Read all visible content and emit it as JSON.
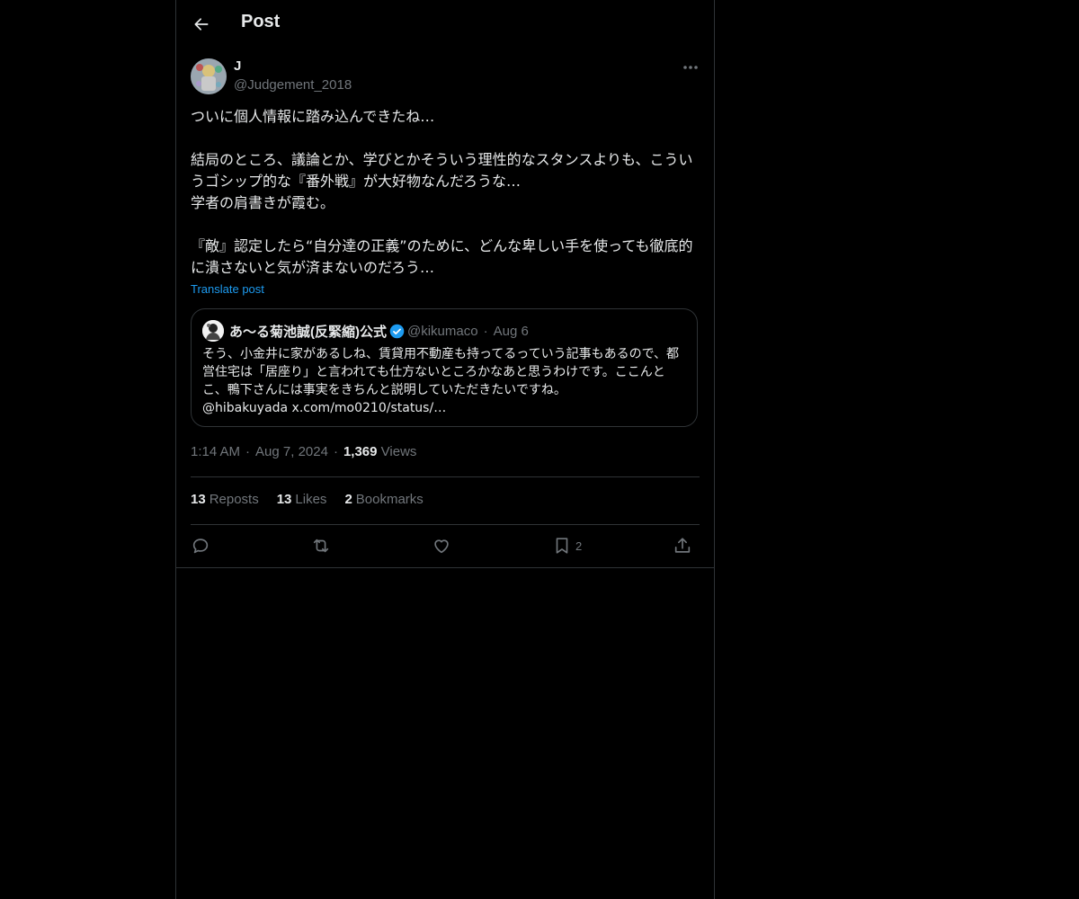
{
  "header": {
    "title": "Post",
    "back_icon": "arrow-left-icon"
  },
  "post": {
    "author": {
      "display_name": "J",
      "handle": "@Judgement_2018"
    },
    "body": "ついに個人情報に踏み込んできたね…\n\n結局のところ、議論とか、学びとかそういう理性的なスタンスよりも、こういうゴシップ的な『番外戦』が大好物なんだろうな…\n学者の肩書きが霞む。\n\n『敵』認定したら“自分達の正義”のために、どんな卑しい手を使っても徹底的に潰さないと気が済まないのだろう…",
    "translate_label": "Translate post",
    "time": "1:14 AM",
    "date": "Aug 7, 2024",
    "views_count": "1,369",
    "views_label": "Views"
  },
  "quote": {
    "display_name": "あ〜る菊池誠(反緊縮)公式",
    "handle": "@kikumaco",
    "date": "Aug 6",
    "text": "そう、小金井に家があるしね、賃貸用不動産も持ってるっていう記事もあるので、都営住宅は「居座り」と言われても仕方ないところかなあと思うわけです。ここんとこ、鴨下さんには事実をきちんと説明していただきたいですね。\n@hibakuyada x.com/mo0210/status/…",
    "verified_color": "#1d9bf0"
  },
  "stats": {
    "reposts_count": "13",
    "reposts_label": "Reposts",
    "likes_count": "13",
    "likes_label": "Likes",
    "bookmarks_count": "2",
    "bookmarks_label": "Bookmarks"
  },
  "actions": {
    "reply_icon": "reply-icon",
    "repost_icon": "repost-icon",
    "like_icon": "heart-icon",
    "bookmark_icon": "bookmark-icon",
    "bookmark_count": "2",
    "share_icon": "share-icon"
  },
  "colors": {
    "background": "#000000",
    "text": "#e7e9ea",
    "muted": "#71767b",
    "accent": "#1d9bf0",
    "border": "#2f3336"
  }
}
